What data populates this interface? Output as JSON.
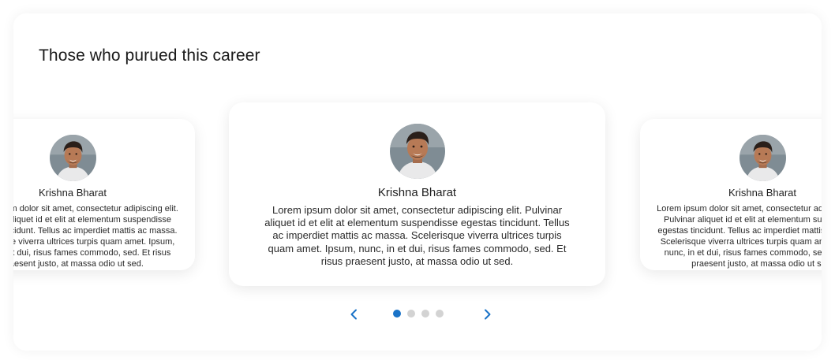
{
  "section": {
    "title": "Those who purued this career"
  },
  "testimonials": [
    {
      "name": "Krishna Bharat",
      "text": "Lorem ipsum dolor sit amet, consectetur adipiscing elit. Pulvinar aliquet id et elit at elementum suspendisse egestas tincidunt. Tellus ac imperdiet mattis ac massa. Scelerisque viverra ultrices turpis quam amet. Ipsum, nunc, in et dui, risus fames commodo, sed. Et risus praesent justo, at massa odio ut sed."
    },
    {
      "name": "Krishna Bharat",
      "text": "Lorem ipsum dolor sit amet, consectetur adipiscing elit. Pulvinar aliquet id et elit at elementum suspendisse egestas tincidunt. Tellus ac imperdiet mattis ac massa. Scelerisque viverra ultrices turpis quam amet. Ipsum, nunc, in et dui, risus fames commodo, sed. Et risus praesent justo, at massa odio ut sed."
    },
    {
      "name": "Krishna Bharat",
      "text": "Lorem ipsum dolor sit amet, consectetur adipiscing elit. Pulvinar aliquet id et elit at elementum suspendisse egestas tincidunt. Tellus ac imperdiet mattis ac massa. Scelerisque viverra ultrices turpis quam amet. Ipsum, nunc, in et dui, risus fames commodo, sed. Et risus praesent justo, at massa odio ut sed."
    }
  ],
  "carousel": {
    "prev_icon": "chevron-left-icon",
    "next_icon": "chevron-right-icon",
    "page_count": 4,
    "active_page": 1
  },
  "colors": {
    "accent": "#1a73c8",
    "dot_inactive": "#d3d3d3",
    "title_text": "#1a1a1a"
  }
}
